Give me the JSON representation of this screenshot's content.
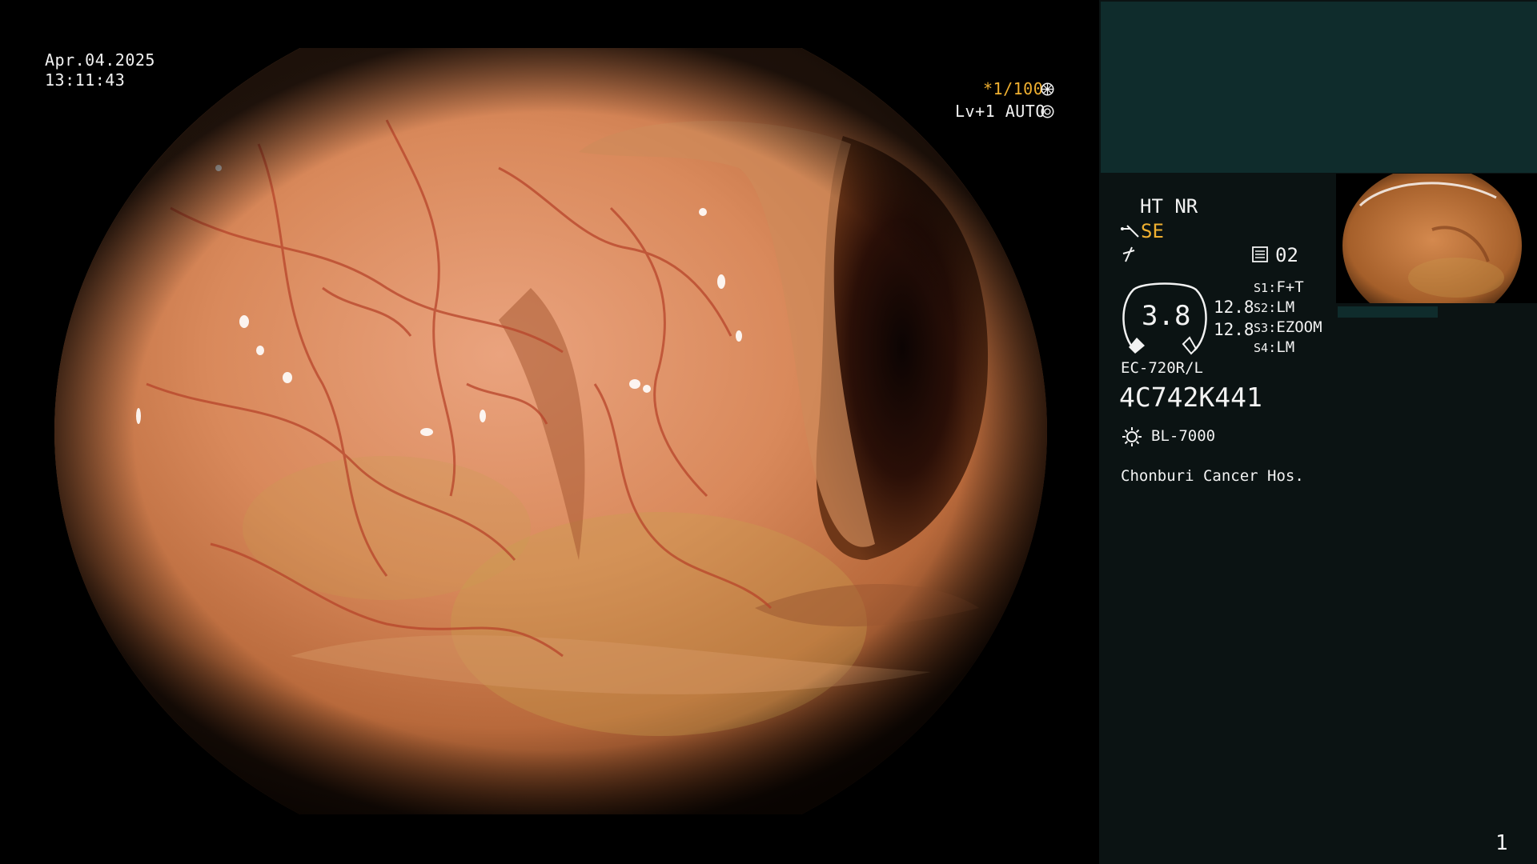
{
  "osd": {
    "date": "Apr.04.2025",
    "time": "13:11:43",
    "shutter": "*1/100",
    "level": "Lv+1 AUTO"
  },
  "panel": {
    "mode": "HT NR",
    "enhance": "SE",
    "memory": "02",
    "dial_value": "3.8",
    "val_top": "12.8",
    "val_bottom": "12.8",
    "switches": [
      {
        "key": "S1",
        "value": "F+T"
      },
      {
        "key": "S2",
        "value": "LM"
      },
      {
        "key": "S3",
        "value": "EZOOM"
      },
      {
        "key": "S4",
        "value": "LM"
      }
    ],
    "scope_model": "EC-720R/L",
    "serial": "4C742K441",
    "light_source": "BL-7000",
    "hospital": "Chonburi Cancer Hos.",
    "page_number": "1"
  },
  "colors": {
    "panel_bg": "#0b1313",
    "panel_top_bg": "#0f2c2c",
    "amber": "#f0b030",
    "text": "#f2f2f2"
  },
  "icons": [
    "shutter-icon",
    "iris-icon",
    "scope-icon",
    "freeze-icon",
    "memory-icon",
    "light-icon"
  ]
}
